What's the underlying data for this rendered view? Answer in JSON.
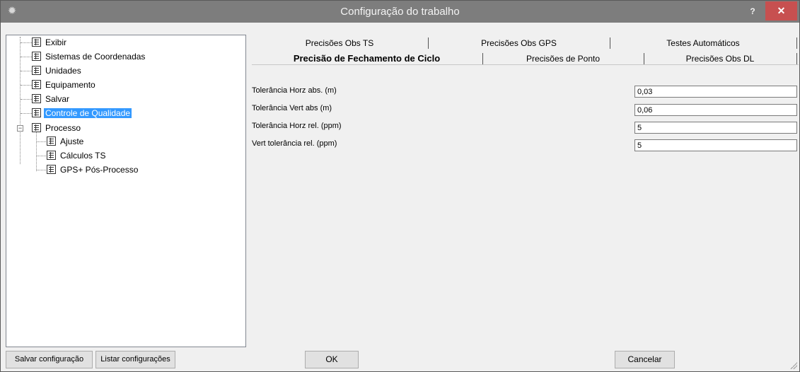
{
  "window": {
    "title": "Configuração do trabalho",
    "help_label": "?",
    "close_label": "✕"
  },
  "tree": {
    "items": [
      {
        "label": "Exibir"
      },
      {
        "label": "Sistemas de Coordenadas"
      },
      {
        "label": "Unidades"
      },
      {
        "label": "Equipamento"
      },
      {
        "label": "Salvar"
      },
      {
        "label": "Controle de Qualidade",
        "selected": true
      },
      {
        "label": "Processo",
        "expanded": true
      },
      {
        "label": "Ajuste"
      },
      {
        "label": "Cálculos TS"
      },
      {
        "label": "GPS+ Pós-Processo"
      }
    ],
    "expander_symbol": "−"
  },
  "tabs": {
    "row1": [
      "Precisões Obs TS",
      "Precisões Obs GPS",
      "Testes Automáticos"
    ],
    "row2": [
      "Precisão de Fechamento de Ciclo",
      "Precisões de Ponto",
      "Precisões Obs DL"
    ],
    "active": "Precisão de Fechamento de Ciclo"
  },
  "fields": [
    {
      "label": "Tolerância Horz abs. (m)",
      "value": "0,03"
    },
    {
      "label": "Tolerância Vert abs (m)",
      "value": "0,06"
    },
    {
      "label": "Tolerância Horz rel. (ppm)",
      "value": "5"
    },
    {
      "label": "Vert tolerância rel. (ppm)",
      "value": "5"
    }
  ],
  "buttons": {
    "save_config": "Salvar configuração",
    "list_configs": "Listar configurações",
    "ok": "OK",
    "cancel": "Cancelar"
  },
  "icons": {
    "app": "gear-icon",
    "tree_item": "list-icon"
  },
  "colors": {
    "titlebar": "#7d7d7d",
    "close": "#c75050",
    "selection": "#3399ff"
  }
}
